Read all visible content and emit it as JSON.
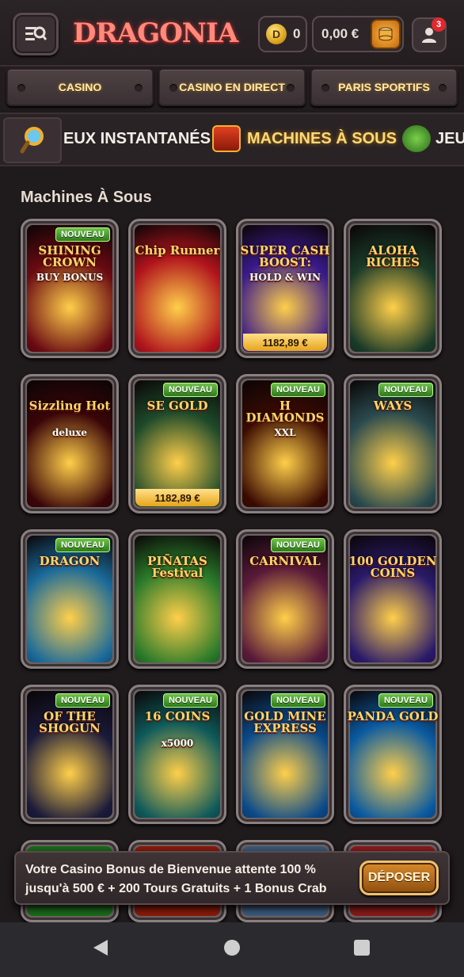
{
  "header": {
    "logo": "DRAGONIA",
    "coins": "0",
    "coin_symbol": "D",
    "balance": "0,00 €",
    "notifications": "3"
  },
  "categories": [
    "CASINO",
    "CASINO EN DIRECT",
    "PARIS SPORTIFS"
  ],
  "subtabs": {
    "instant": "EUX INSTANTANÉS",
    "slots": "MACHINES À SOUS",
    "games": "JEU"
  },
  "section_title": "Machines À Sous",
  "games": [
    {
      "title": "SHINING CROWN",
      "sub": "BUY BONUS",
      "badge": "NOUVEAU",
      "jackpot": "",
      "bg": "#6a0a12"
    },
    {
      "title": "Chip Runner",
      "sub": "",
      "badge": "",
      "jackpot": "",
      "bg": "#b0141c"
    },
    {
      "title": "SUPER CASH BOOST:",
      "sub": "HOLD & WIN",
      "badge": "",
      "jackpot": "1182,89 €",
      "bg": "#3a1a8a"
    },
    {
      "title": "ALOHA RICHES",
      "sub": "",
      "badge": "",
      "jackpot": "",
      "bg": "#1a3a28"
    },
    {
      "title": "Sizzling Hot",
      "sub": "deluxe",
      "badge": "",
      "jackpot": "",
      "bg": "#3a0508"
    },
    {
      "title": "SE GOLD",
      "sub": "",
      "badge": "NOUVEAU",
      "jackpot": "1182,89 €",
      "bg": "#1e4a2a"
    },
    {
      "title": "H DIAMONDS",
      "sub": "XXL",
      "badge": "NOUVEAU",
      "jackpot": "",
      "bg": "#3a0a02"
    },
    {
      "title": "WAYS",
      "sub": "",
      "badge": "NOUVEAU",
      "jackpot": "",
      "bg": "#2a4a4e"
    },
    {
      "title": "DRAGON",
      "sub": "",
      "badge": "NOUVEAU",
      "jackpot": "",
      "bg": "#1a6a9a"
    },
    {
      "title": "PIÑATAS Festival",
      "sub": "",
      "badge": "",
      "jackpot": "",
      "bg": "#2a7a2a"
    },
    {
      "title": "CARNIVAL",
      "sub": "",
      "badge": "NOUVEAU",
      "jackpot": "",
      "bg": "#5a1a3a"
    },
    {
      "title": "100 GOLDEN COINS",
      "sub": "",
      "badge": "",
      "jackpot": "",
      "bg": "#2a1a6a"
    },
    {
      "title": "OF THE SHOGUN",
      "sub": "",
      "badge": "NOUVEAU",
      "jackpot": "",
      "bg": "#1a1a3a"
    },
    {
      "title": "16 COINS",
      "sub": "x5000",
      "badge": "NOUVEAU",
      "jackpot": "",
      "bg": "#0f5a5a"
    },
    {
      "title": "GOLD MINE EXPRESS",
      "sub": "",
      "badge": "NOUVEAU",
      "jackpot": "",
      "bg": "#0a4a8a"
    },
    {
      "title": "PANDA GOLD",
      "sub": "",
      "badge": "NOUVEAU",
      "jackpot": "",
      "bg": "#0a5aa0"
    }
  ],
  "promo": {
    "text": "Votre Casino Bonus de Bienvenue attente 100 % jusqu'à 500 € + 200 Tours Gratuits + 1 Bonus Crab",
    "button": "DÉPOSER"
  },
  "colors": {
    "accent_gold": "#ffd977",
    "badge_green": "#4a9e2e",
    "notification_red": "#e0282e",
    "deposit_orange": "#c87a20"
  }
}
